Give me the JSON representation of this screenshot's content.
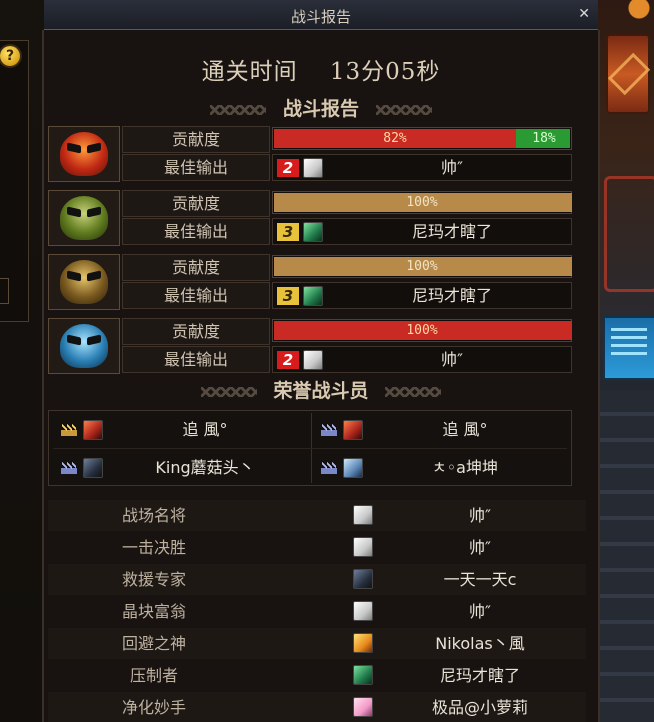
{
  "window": {
    "title": "战斗报告",
    "close_icon": "✕"
  },
  "clear_time": {
    "label": "通关时间",
    "value": "13分05秒"
  },
  "sections": {
    "battle_report": "战斗报告",
    "honor": "荣誉战斗员"
  },
  "rows": [
    {
      "portrait_icon": "red-demon-mask-icon",
      "contribution_label": "贡献度",
      "best_label": "最佳输出",
      "bar": {
        "percent": 82,
        "text": "82%",
        "color": "#c92a24",
        "second_percent": 18,
        "second_text": "18%",
        "second_color": "#2a9a32"
      },
      "rank": "2",
      "player": "帅″",
      "avatar": "white-hair-avatar-icon"
    },
    {
      "portrait_icon": "green-demon-mask-icon",
      "contribution_label": "贡献度",
      "best_label": "最佳输出",
      "bar": {
        "percent": 100,
        "text": "100%",
        "color": "#b88a4a"
      },
      "rank": "3",
      "player": "尼玛才瞎了",
      "avatar": "green-armor-avatar-icon"
    },
    {
      "portrait_icon": "gold-demon-mask-icon",
      "contribution_label": "贡献度",
      "best_label": "最佳输出",
      "bar": {
        "percent": 100,
        "text": "100%",
        "color": "#b88a4a"
      },
      "rank": "3",
      "player": "尼玛才瞎了",
      "avatar": "green-armor-avatar-icon"
    },
    {
      "portrait_icon": "blue-demon-mask-icon",
      "contribution_label": "贡献度",
      "best_label": "最佳输出",
      "bar": {
        "percent": 100,
        "text": "100%",
        "color": "#c92a24"
      },
      "rank": "2",
      "player": "帅″",
      "avatar": "white-hair-avatar-icon"
    }
  ],
  "honor": [
    {
      "name": "追 風°",
      "crown": "gold",
      "avatar": "white-hair-red-avatar-icon"
    },
    {
      "name": "追 風°",
      "crown": "silver",
      "avatar": "white-hair-red-avatar-icon"
    },
    {
      "name": "King蘑菇头丶",
      "crown": "silver",
      "avatar": "dark-red-avatar-icon"
    },
    {
      "name": "ㅊ◦a坤坤",
      "crown": "silver",
      "avatar": "blue-knight-avatar-icon"
    }
  ],
  "awards": [
    {
      "title": "战场名将",
      "player": "帅″",
      "avatar": "white"
    },
    {
      "title": "一击决胜",
      "player": "帅″",
      "avatar": "white"
    },
    {
      "title": "救援专家",
      "player": "一天一天c",
      "avatar": "dark"
    },
    {
      "title": "晶块富翁",
      "player": "帅″",
      "avatar": "white"
    },
    {
      "title": "回避之神",
      "player": "Nikolas丶風",
      "avatar": "orange"
    },
    {
      "title": "压制者",
      "player": "尼玛才瞎了",
      "avatar": "green"
    },
    {
      "title": "净化妙手",
      "player": "极品@小萝莉",
      "avatar": "pink"
    }
  ]
}
